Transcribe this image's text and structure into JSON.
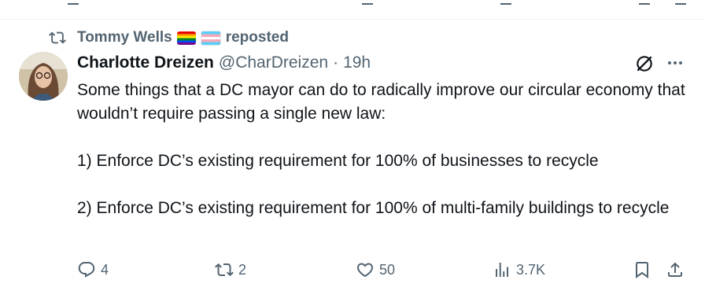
{
  "repost": {
    "user": "Tommy Wells",
    "label": "reposted",
    "flags": [
      "rainbow-flag",
      "transgender-flag"
    ]
  },
  "tweet": {
    "author_name": "Charlotte Dreizen",
    "handle": "@CharDreizen",
    "separator": "·",
    "time": "19h",
    "paragraphs": [
      "Some things that a DC mayor can do to radically improve our circular economy that wouldn’t require passing a single new law:",
      "1) Enforce DC’s existing requirement for 100% of businesses to recycle",
      "2) Enforce DC’s existing requirement for 100% of multi-family buildings to recycle"
    ]
  },
  "actions": {
    "replies": "4",
    "reposts": "2",
    "likes": "50",
    "views": "3.7K"
  },
  "icons": {
    "repost": "repost-icon",
    "grok": "grok-icon",
    "more": "more-icon",
    "reply": "reply-icon",
    "like": "heart-icon",
    "views": "views-icon",
    "bookmark": "bookmark-icon",
    "share": "share-icon"
  },
  "colors": {
    "text": "#0f1419",
    "secondary": "#536471",
    "divider": "#eff3f4"
  }
}
